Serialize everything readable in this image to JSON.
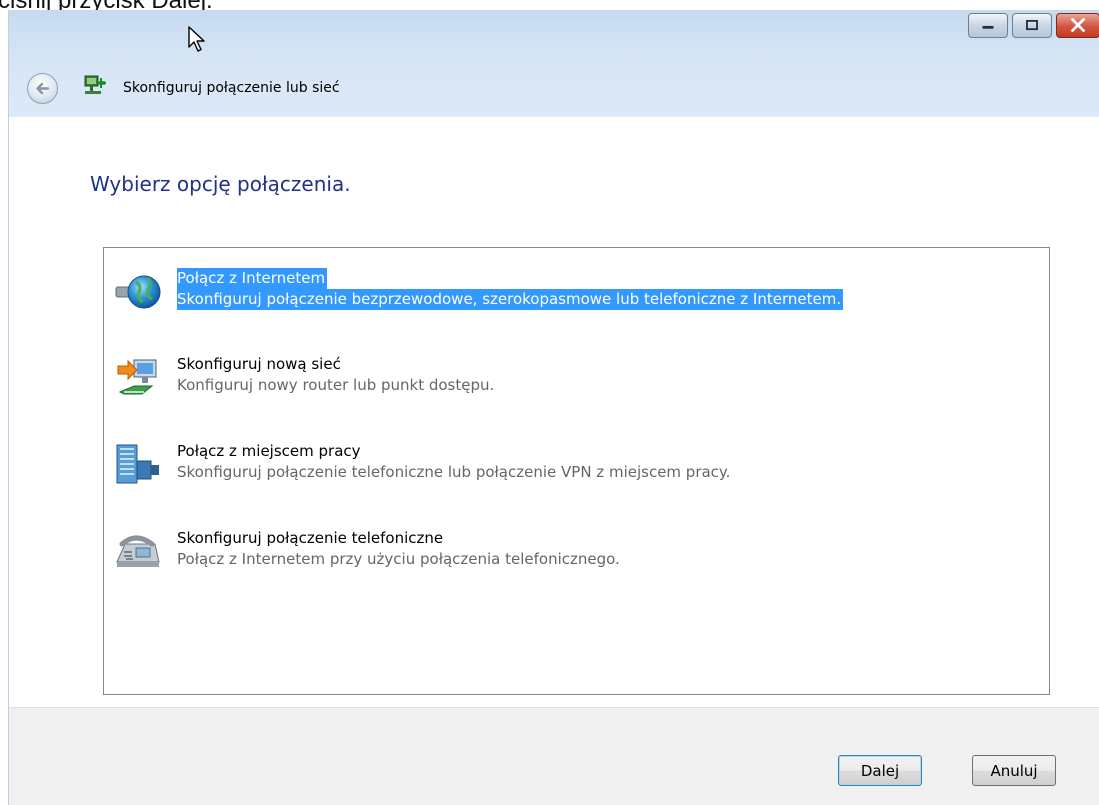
{
  "doc_fragment": "ciśnij przycisk Dalej.",
  "window": {
    "title": "Skonfiguruj połączenie lub sieć",
    "controls": {
      "minimize": "minimize-icon",
      "maximize": "maximize-icon",
      "close": "close-icon"
    }
  },
  "main_instruction": "Wybierz opcję połączenia.",
  "options": [
    {
      "title": "Połącz z Internetem",
      "description": "Skonfiguruj połączenie bezprzewodowe, szerokopasmowe lub telefoniczne z Internetem.",
      "selected": true,
      "icon": "globe-network-icon"
    },
    {
      "title": "Skonfiguruj nową sieć",
      "description": "Konfiguruj nowy router lub punkt dostępu.",
      "selected": false,
      "icon": "new-network-icon"
    },
    {
      "title": "Połącz z miejscem pracy",
      "description": "Skonfiguruj połączenie telefoniczne lub połączenie VPN z miejscem pracy.",
      "selected": false,
      "icon": "workplace-building-icon"
    },
    {
      "title": "Skonfiguruj połączenie telefoniczne",
      "description": "Połącz z Internetem przy użyciu połączenia telefonicznego.",
      "selected": false,
      "icon": "telephone-modem-icon"
    }
  ],
  "buttons": {
    "next": "Dalej",
    "cancel": "Anuluj"
  },
  "colors": {
    "selection": "#3399ff",
    "instruction": "#1e3287"
  }
}
